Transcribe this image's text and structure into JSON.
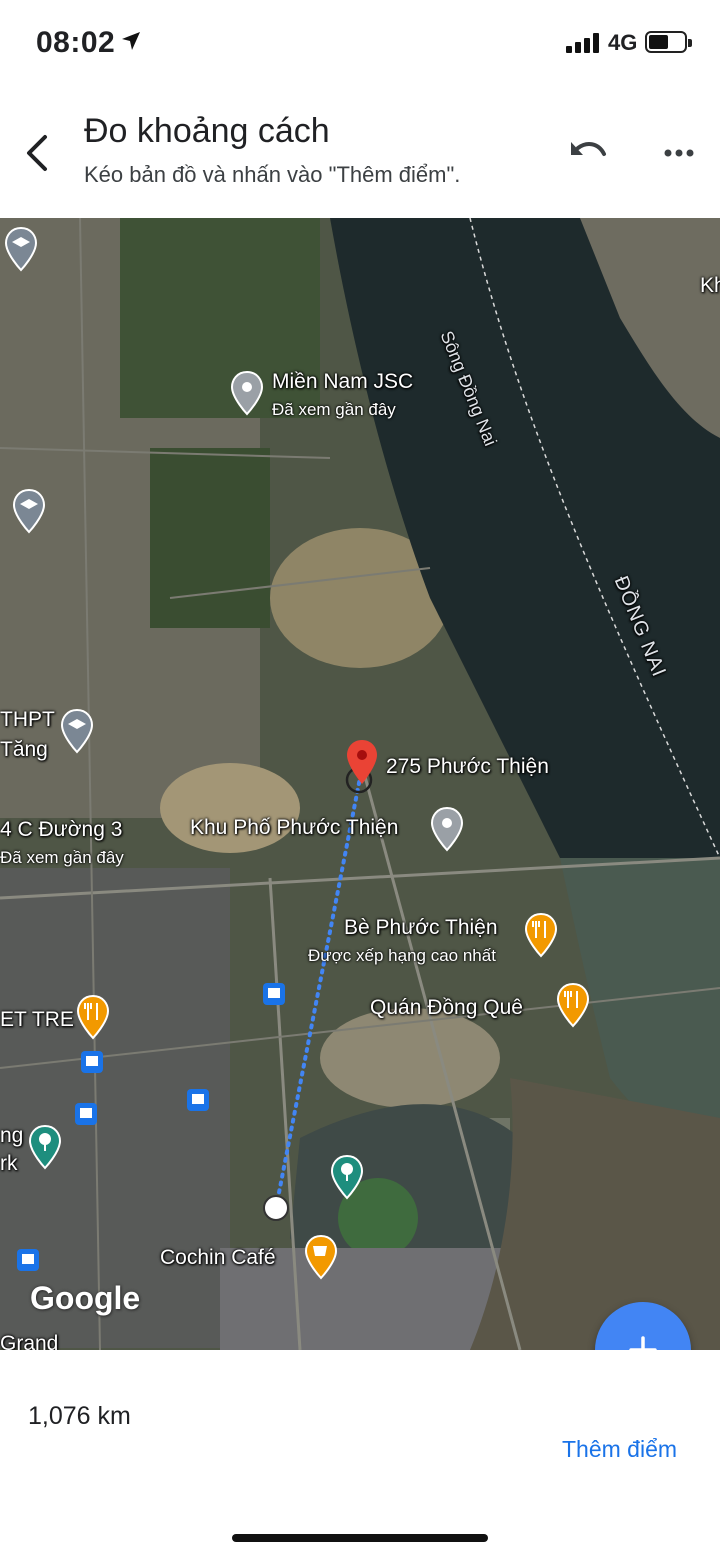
{
  "status_bar": {
    "time": "08:02",
    "network": "4G",
    "battery_level": 0.55
  },
  "header": {
    "title": "Đo khoảng cách",
    "subtitle": "Kéo bản đồ và nhấn vào \"Thêm điểm\".",
    "back_icon": "back-arrow-icon",
    "undo_icon": "undo-icon",
    "more_icon": "more-options-icon"
  },
  "map": {
    "labels": {
      "mien_nam": "Miền Nam JSC",
      "mien_nam_sub": "Đã xem gần đây",
      "song_dong_nai": "Sông Đồng Nai",
      "dong_nai": "ĐỒNG NAI",
      "thpt": "THPT",
      "tang": "Tăng",
      "duong3": "4 C Đường 3",
      "duong3_sub": "Đã xem gần đây",
      "phuoc_thien_275": "275 Phước Thiện",
      "khu_pho": "Khu Phố Phước Thiện",
      "be_phuoc_thien": "Bè Phước Thiện",
      "be_sub": "Được xếp hạng cao nhất",
      "quan_dong_que": "Quán Đồng Quê",
      "et_tre": "ET TRE",
      "cochin": "Cochin Café",
      "ng": "ng",
      "rk": "rk",
      "grand": "Grand",
      "kh": "Kh",
      "google": "Google"
    },
    "colors": {
      "water": "#1e2a2c",
      "water_light": "#4a5a50",
      "pin_red": "#ea4335",
      "route_blue": "#4285f4",
      "food_orange": "#f29900"
    }
  },
  "bottom": {
    "distance": "1,076 km",
    "add_point_label": "Thêm điểm",
    "fab_icon": "plus-icon"
  }
}
